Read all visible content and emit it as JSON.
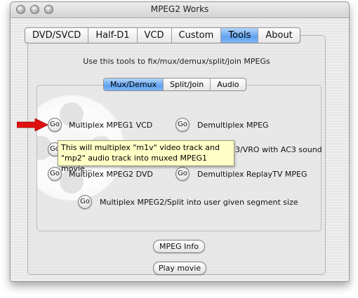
{
  "window": {
    "title": "MPEG2 Works"
  },
  "tabs": [
    {
      "label": "DVD/SVCD"
    },
    {
      "label": "Half-D1"
    },
    {
      "label": "VCD"
    },
    {
      "label": "Custom"
    },
    {
      "label": "Tools",
      "active": true
    },
    {
      "label": "About"
    }
  ],
  "description": "Use this tools to fix/mux/demux/split/join MPEGs",
  "subtabs": [
    {
      "label": "Mux/Demux",
      "active": true
    },
    {
      "label": "Split/Join"
    },
    {
      "label": "Audio"
    }
  ],
  "go_label": "Go",
  "actions": {
    "mux_mpeg1_vcd": "Multiplex MPEG1 VCD",
    "demux_mpeg": "Demultiplex MPEG",
    "demux_vob_vro_visible": "3/VRO with AC3 sound",
    "mux_mpeg2_dvd": "Multiplex MPEG2 DVD",
    "demux_replaytv": "Demultiplex ReplayTV MPEG",
    "mux_mpeg2_split": "Multiplex MPEG2/Split into user given segment size"
  },
  "tooltip": {
    "line1": "This will multiplex \"m1v\" video track and",
    "line2": "\"mp2\" audio track into muxed MPEG1 movie..."
  },
  "buttons": {
    "mpeg_info": "MPEG Info",
    "play_movie": "Play movie"
  },
  "colors": {
    "accent_tab": "#5fa2ef",
    "tooltip_bg": "#ffffc6",
    "arrow": "#e01010"
  }
}
